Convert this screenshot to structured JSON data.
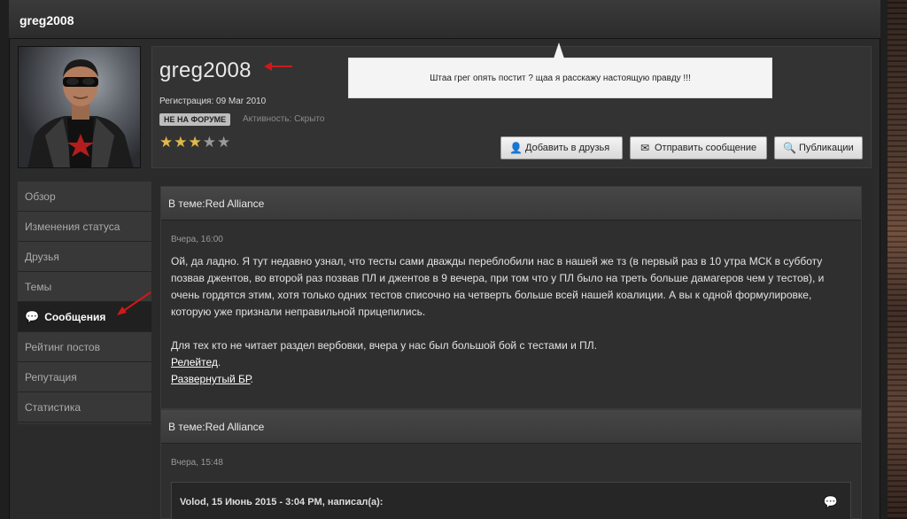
{
  "window": {
    "title": "greg2008"
  },
  "profile": {
    "username": "greg2008",
    "registration": "Регистрация: 09 Mar 2010",
    "online_status": "НЕ НА ФОРУМЕ",
    "activity": "Активность: Скрыто",
    "rating_stars": 3,
    "rating_max": 5
  },
  "tooltip": {
    "text": "Штаа грег опять постит ? щаа я расскажу настоящую правду !!!"
  },
  "buttons": {
    "add_friend": "Добавить в друзья",
    "send_message": "Отправить сообщение",
    "publications": "Публикации"
  },
  "sidebar": {
    "items": [
      {
        "label": "Обзор",
        "active": false
      },
      {
        "label": "Изменения статуса",
        "active": false
      },
      {
        "label": "Друзья",
        "active": false
      },
      {
        "label": "Темы",
        "active": false
      },
      {
        "label": "Сообщения",
        "active": true
      },
      {
        "label": "Рейтинг постов",
        "active": false
      },
      {
        "label": "Репутация",
        "active": false
      },
      {
        "label": "Статистика",
        "active": false
      }
    ]
  },
  "posts": [
    {
      "topic": "В теме:Red Alliance",
      "date": "Вчера, 16:00",
      "paragraph1": "Ой, да ладно. Я тут недавно узнал, что тесты сами дважды переблобили нас в нашей же тз (в первый раз в 10 утра МСК в субботу позвав джентов, во второй раз позвав ПЛ и джентов в 9 вечера, при том что у ПЛ было на треть больше дамагеров чем у тестов), и очень гордятся этим, хотя только одних тестов списочно на четверть больше всей нашей коалиции. А вы к одной формулировке, которую уже признали неправильной прицепились.",
      "paragraph2": "Для тех кто не читает раздел вербовки, вчера у нас был большой бой с тестами и ПЛ.",
      "link1": "Релейтед",
      "link1_suffix": ".",
      "link2": "Развернутый БР",
      "link2_suffix": "."
    },
    {
      "topic": "В теме:Red Alliance",
      "date": "Вчера, 15:48",
      "quote_header": "Volod, 15 Июнь 2015 - 3:04 PM, написал(а):"
    }
  ],
  "colors": {
    "star": "#e0b94a",
    "arrow": "#d01818",
    "accent_bg": "#2b2b2b"
  },
  "icons": {
    "friend": "add-user-icon",
    "message": "envelope-icon",
    "publications": "search-icon",
    "sidebar_active": "messages-icon",
    "quote": "speech-bubble-icon"
  }
}
